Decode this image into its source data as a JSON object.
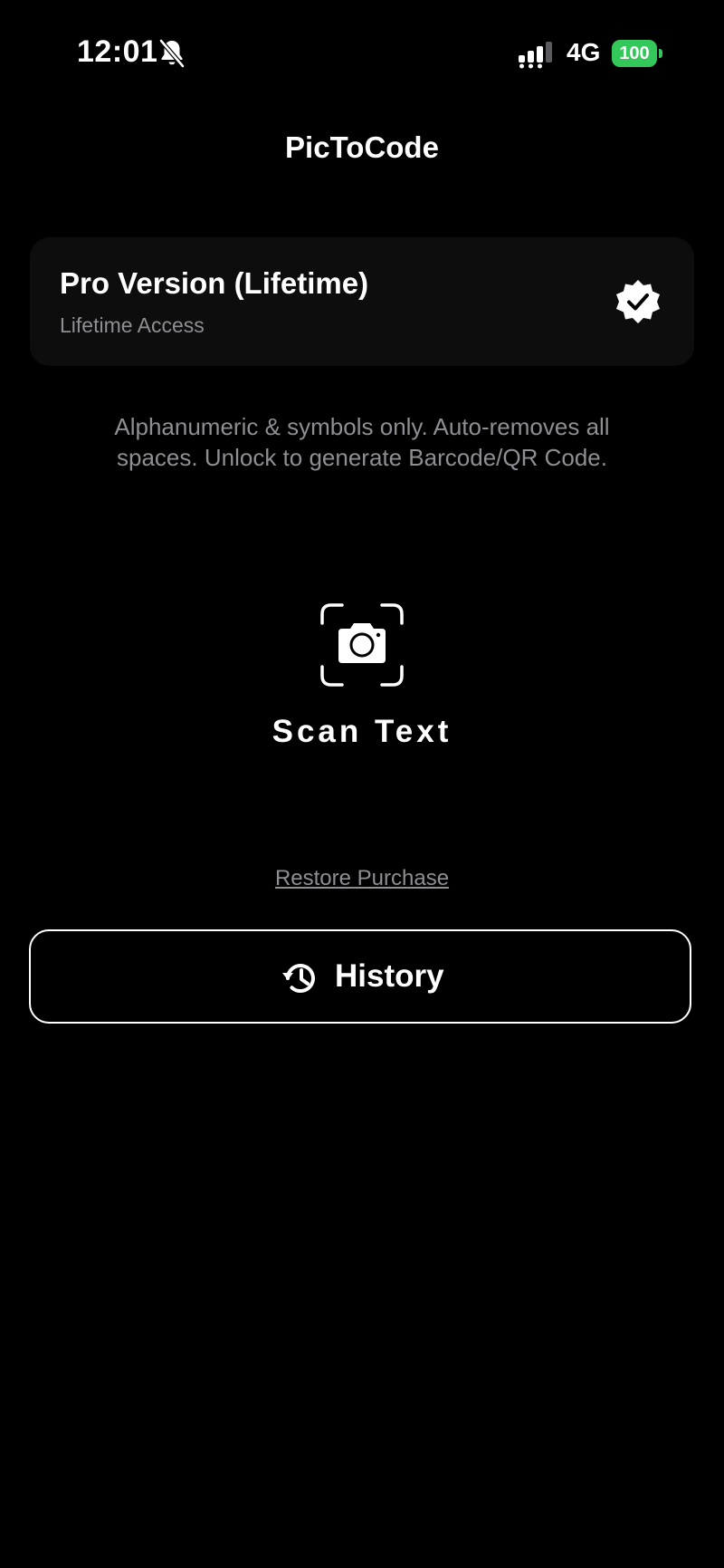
{
  "status_bar": {
    "time": "12:01",
    "network": "4G",
    "battery": "100",
    "icons": [
      "bell-slash-icon",
      "signal-icon",
      "battery-icon"
    ],
    "battery_color": "#34c759"
  },
  "header": {
    "title": "PicToCode"
  },
  "pro_card": {
    "title": "Pro Version (Lifetime)",
    "subtitle": "Lifetime Access",
    "icon": "verified-badge-icon"
  },
  "description": "Alphanumeric & symbols only. Auto-removes all spaces. Unlock to generate Barcode/QR Code.",
  "scan": {
    "label": "Scan Text",
    "icon": "camera-scan-icon"
  },
  "restore": {
    "label": "Restore Purchase"
  },
  "history": {
    "label": "History",
    "icon": "history-icon"
  },
  "colors": {
    "background": "#000000",
    "text": "#ffffff",
    "secondary_text": "#8e8e93",
    "card": "#0d0d0d"
  }
}
